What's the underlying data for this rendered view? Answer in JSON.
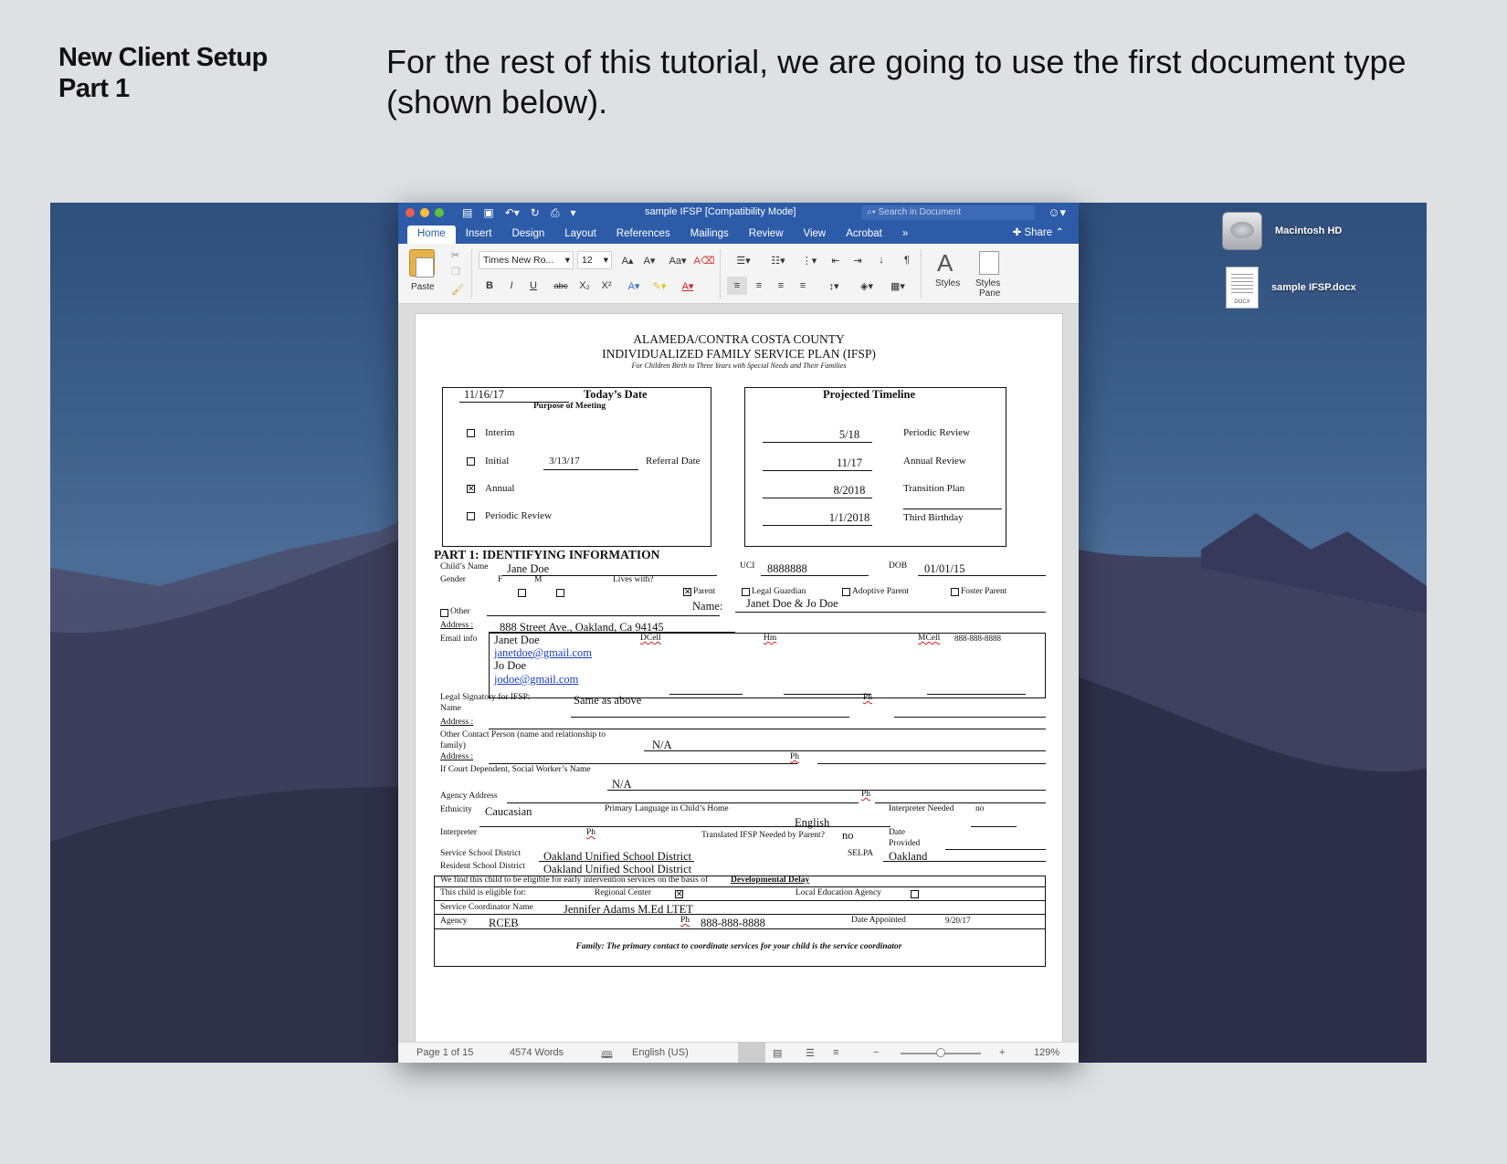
{
  "slide": {
    "heading_line1": "New Client Setup",
    "heading_line2": "Part 1",
    "body": "For the rest of this tutorial, we are going to use the first document type (shown below)."
  },
  "desktop": {
    "icons": [
      {
        "name": "Macintosh HD"
      },
      {
        "name": "sample IFSP.docx",
        "badge": "DOCX"
      }
    ]
  },
  "word": {
    "title": "sample IFSP [Compatibility Mode]",
    "search_placeholder": "Search in Document",
    "tabs": [
      "Home",
      "Insert",
      "Design",
      "Layout",
      "References",
      "Mailings",
      "Review",
      "View",
      "Acrobat"
    ],
    "more_tabs": "»",
    "share": "Share",
    "ribbon": {
      "paste": "Paste",
      "font_name": "Times New Ro...",
      "font_size": "12",
      "bold": "B",
      "italic": "I",
      "underline": "U",
      "strike": "abc",
      "sub": "X₂",
      "sup": "X²",
      "styles": "Styles",
      "styles_pane_1": "Styles",
      "styles_pane_2": "Pane"
    },
    "status": {
      "page": "Page 1 of 15",
      "words": "4574 Words",
      "language": "English (US)",
      "zoom": "129%",
      "zoom_minus": "−",
      "zoom_plus": "+"
    }
  },
  "doc": {
    "h1": "ALAMEDA/CONTRA COSTA COUNTY",
    "h2": "INDIVIDUALIZED FAMILY SERVICE PLAN (IFSP)",
    "h3": "For Children Birth to Three Years with Special Needs and Their Families",
    "todays_date_value": "11/16/17",
    "todays_date_label": "Today’s Date",
    "purpose": "Purpose of Meeting",
    "purpose_items": [
      {
        "label": "Interim",
        "checked": false
      },
      {
        "label": "Initial",
        "checked": false
      },
      {
        "label": "Annual",
        "checked": true
      },
      {
        "label": "Periodic Review",
        "checked": false
      }
    ],
    "referral_date_value": "3/13/17",
    "referral_date_label": "Referral Date",
    "timeline_title": "Projected Timeline",
    "timeline": [
      {
        "value": "5/18",
        "label": "Periodic Review"
      },
      {
        "value": "11/17",
        "label": "Annual Review"
      },
      {
        "value": "8/2018",
        "label": "Transition Plan"
      },
      {
        "value": "1/1/2018",
        "label": "Third Birthday"
      }
    ],
    "part1": "PART 1:  IDENTIFYING INFORMATION",
    "child_name_label": "Child’s Name",
    "child_name": "Jane Doe",
    "uci_label": "UCI",
    "uci": "8888888",
    "dob_label": "DOB",
    "dob": "01/01/15",
    "gender_label": "Gender",
    "gender_f": "F",
    "gender_m": "M",
    "lives_with": "Lives with?",
    "parent": "Parent",
    "legal_guardian": "Legal Guardian",
    "adoptive_parent": "Adoptive Parent",
    "foster_parent": "Foster Parent",
    "other": "Other",
    "name_label": "Name:",
    "name_value": "Janet Doe & Jo Doe",
    "address_label": "Address :",
    "address_value": "888 Street Ave., Oakland, Ca 94145",
    "email_label": "Email info",
    "email_name1": "Janet Doe",
    "email1": "janetdoe@gmail.com",
    "email_name2": "Jo Doe",
    "email2": "jodoe@gmail.com",
    "dcell": "DCell",
    "hm": "Hm",
    "mcell": "MCell",
    "mcell_value": "888-888-8888",
    "legal_sig_label": "Legal Signatory for IFSP:",
    "legal_sig_label2": "Name",
    "legal_sig_value": "Same as above",
    "ph": "Ph",
    "other_contact_label": "Other Contact Person (name and relationship to",
    "other_contact_label2": "family)",
    "other_contact_value": "N/A",
    "court_label": "If Court Dependent, Social Worker’s Name",
    "court_value": "N/A",
    "agency_address_label": "Agency Address",
    "ethnicity_label": "Ethnicity",
    "ethnicity": "Caucasian",
    "primary_lang_label": "Primary Language in Child’s Home",
    "primary_lang": "English",
    "interp_needed_label": "Interpreter Needed",
    "interp_needed": "no",
    "interpreter_label": "Interpreter",
    "translated_label": "Translated IFSP Needed by Parent?",
    "translated": "no",
    "date_provided_1": "Date",
    "date_provided_2": "Provided",
    "service_district_label": "Service School District",
    "service_district": "Oakland Unified School District",
    "selpa_label": "SELPA",
    "selpa": "Oakland",
    "resident_district_label": "Resident School District",
    "resident_district": "Oakland Unified School District",
    "eligible_text": "We find this child to be eligible for early intervention services on the basis of",
    "eligible_basis": "Developmental Delay",
    "eligible_for_label": "This child is eligible for:",
    "regional_center": "Regional Center",
    "local_edu": "Local Education Agency",
    "coord_label": "Service Coordinator Name",
    "coord_value": "Jennifer Adams M.Ed LTET",
    "agency_label": "Agency",
    "agency_value": "RCEB",
    "agency_ph": "888-888-8888",
    "date_appointed_label": "Date Appointed",
    "date_appointed": "9/20/17",
    "family_note": "Family:  The primary contact to coordinate services for your child is the service coordinator"
  }
}
